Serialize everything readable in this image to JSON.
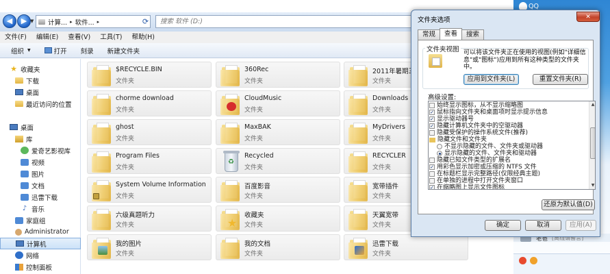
{
  "address": {
    "path_parts": [
      "计算...",
      "软件...",
      "▸"
    ],
    "search_placeholder": "搜索 软件 (D:)"
  },
  "menubar": [
    "文件(F)",
    "编辑(E)",
    "查看(V)",
    "工具(T)",
    "帮助(H)"
  ],
  "toolbar": {
    "organize": "组织",
    "open": "打开",
    "burn": "刻录",
    "new_folder": "新建文件夹"
  },
  "navpane": {
    "items": [
      {
        "label": "收藏夹",
        "icon": "star-icon"
      },
      {
        "label": "下载",
        "icon": "folder-icon"
      },
      {
        "label": "桌面",
        "icon": "desktop-icon"
      },
      {
        "label": "最近访问的位置",
        "icon": "recent-icon"
      },
      {
        "label": "桌面",
        "icon": "desktop-icon"
      },
      {
        "label": "库",
        "icon": "library-icon"
      },
      {
        "label": "爱奇艺影视库",
        "icon": "iqiyi-icon"
      },
      {
        "label": "视频",
        "icon": "video-icon"
      },
      {
        "label": "图片",
        "icon": "picture-icon"
      },
      {
        "label": "文档",
        "icon": "document-icon"
      },
      {
        "label": "迅雷下载",
        "icon": "thunder-icon"
      },
      {
        "label": "音乐",
        "icon": "music-icon"
      },
      {
        "label": "家庭组",
        "icon": "homegroup-icon"
      },
      {
        "label": "Administrator",
        "icon": "user-icon"
      },
      {
        "label": "计算机",
        "icon": "computer-icon"
      },
      {
        "label": "网络",
        "icon": "network-icon"
      },
      {
        "label": "控制面板",
        "icon": "control-panel-icon"
      }
    ]
  },
  "files": [
    {
      "name": "$RECYCLE.BIN",
      "type": "文件夹"
    },
    {
      "name": "360Rec",
      "type": "文件夹"
    },
    {
      "name": "2011年暑期三",
      "type": "文件夹"
    },
    {
      "name": "chorme download",
      "type": "文件夹"
    },
    {
      "name": "CloudMusic",
      "type": "文件夹"
    },
    {
      "name": "Downloads",
      "type": "文件夹"
    },
    {
      "name": "ghost",
      "type": "文件夹"
    },
    {
      "name": "MaxBAK",
      "type": "文件夹"
    },
    {
      "name": "MyDrivers",
      "type": "文件夹"
    },
    {
      "name": "Program Files",
      "type": "文件夹"
    },
    {
      "name": "Recycled",
      "type": "文件夹"
    },
    {
      "name": "RECYCLER",
      "type": "文件夹"
    },
    {
      "name": "System Volume Information",
      "type": "文件夹"
    },
    {
      "name": "百度影音",
      "type": "文件夹"
    },
    {
      "name": "宽带插件",
      "type": "文件夹"
    },
    {
      "name": "六级真题听力",
      "type": "文件夹"
    },
    {
      "name": "收藏夹",
      "type": "文件夹"
    },
    {
      "name": "天翼宽带",
      "type": "文件夹"
    },
    {
      "name": "我的图片",
      "type": "文件夹"
    },
    {
      "name": "我的文档",
      "type": "文件夹"
    },
    {
      "name": "迅雷下载",
      "type": "文件夹"
    }
  ],
  "dialog": {
    "title": "文件夹选项",
    "close": "✕",
    "tabs": [
      "常规",
      "查看",
      "搜索"
    ],
    "folder_view_label": "文件夹视图",
    "folder_view_desc": "可以将该文件夹正在使用的视图(例如\"详细信息\"或\"图标\")应用到所有这种类型的文件夹中。",
    "apply_to_folders": "应用到文件夹(L)",
    "reset_folders": "重置文件夹(R)",
    "advanced_label": "高级设置:",
    "settings": [
      {
        "label": "始终显示图标，从不显示缩略图",
        "kind": "checkbox",
        "checked": false
      },
      {
        "label": "鼠标指向文件夹和桌面项时显示提示信息",
        "kind": "checkbox",
        "checked": true
      },
      {
        "label": "显示驱动器号",
        "kind": "checkbox",
        "checked": true
      },
      {
        "label": "隐藏计算机文件夹中的空驱动器",
        "kind": "checkbox",
        "checked": true
      },
      {
        "label": "隐藏受保护的操作系统文件(推荐)",
        "kind": "checkbox",
        "checked": false
      },
      {
        "label": "隐藏文件和文件夹",
        "kind": "folder",
        "checked": false
      },
      {
        "label": "不显示隐藏的文件、文件夹或驱动器",
        "kind": "radio",
        "checked": false
      },
      {
        "label": "显示隐藏的文件、文件夹和驱动器",
        "kind": "radio",
        "checked": true
      },
      {
        "label": "隐藏已知文件类型的扩展名",
        "kind": "checkbox",
        "checked": false
      },
      {
        "label": "用彩色显示加密或压缩的 NTFS 文件",
        "kind": "checkbox",
        "checked": true
      },
      {
        "label": "在标题栏显示完整路径(仅限经典主题)",
        "kind": "checkbox",
        "checked": false
      },
      {
        "label": "在单独的进程中打开文件夹窗口",
        "kind": "checkbox",
        "checked": false
      },
      {
        "label": "在缩略图上显示文件图标",
        "kind": "checkbox",
        "checked": true
      }
    ],
    "restore_defaults": "还原为默认值(D)",
    "ok": "确定",
    "cancel": "取消",
    "apply": "应用(A)"
  },
  "qq": {
    "title": "QQ",
    "contact_name": "老爸",
    "contact_status": "[离线请留言]"
  }
}
